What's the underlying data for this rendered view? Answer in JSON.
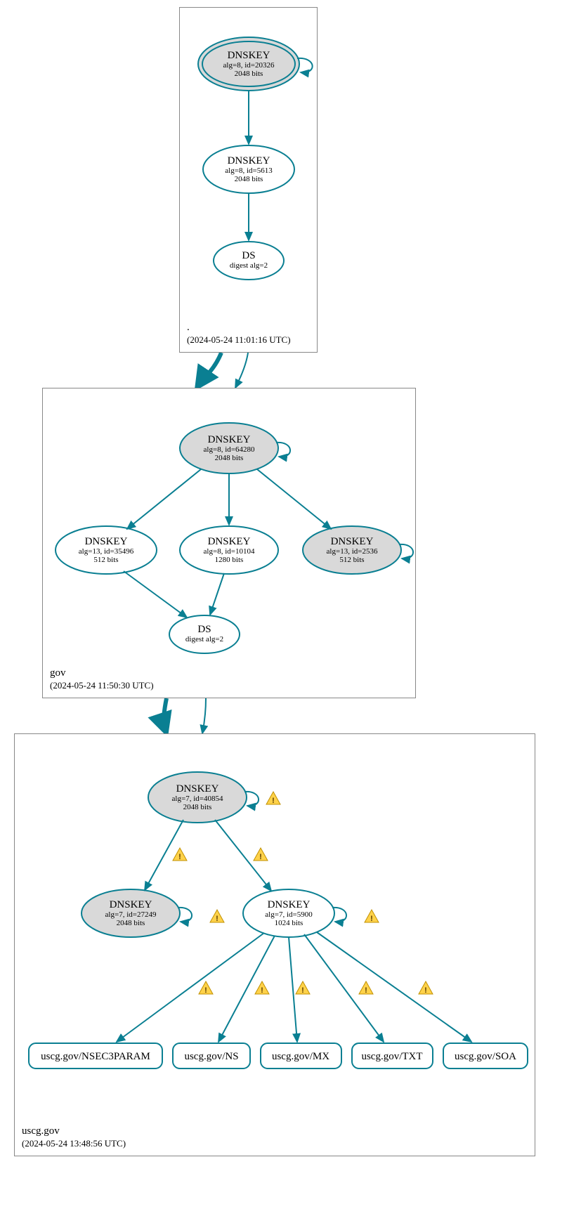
{
  "zones": {
    "root": {
      "name": ".",
      "timestamp": "(2024-05-24 11:01:16 UTC)"
    },
    "gov": {
      "name": "gov",
      "timestamp": "(2024-05-24 11:50:30 UTC)"
    },
    "uscg": {
      "name": "uscg.gov",
      "timestamp": "(2024-05-24 13:48:56 UTC)"
    }
  },
  "nodes": {
    "root_ksk": {
      "title": "DNSKEY",
      "line1": "alg=8, id=20326",
      "line2": "2048 bits"
    },
    "root_zsk": {
      "title": "DNSKEY",
      "line1": "alg=8, id=5613",
      "line2": "2048 bits"
    },
    "root_ds": {
      "title": "DS",
      "line1": "digest alg=2"
    },
    "gov_ksk": {
      "title": "DNSKEY",
      "line1": "alg=8, id=64280",
      "line2": "2048 bits"
    },
    "gov_k1": {
      "title": "DNSKEY",
      "line1": "alg=13, id=35496",
      "line2": "512 bits"
    },
    "gov_k2": {
      "title": "DNSKEY",
      "line1": "alg=8, id=10104",
      "line2": "1280 bits"
    },
    "gov_k3": {
      "title": "DNSKEY",
      "line1": "alg=13, id=2536",
      "line2": "512 bits"
    },
    "gov_ds": {
      "title": "DS",
      "line1": "digest alg=2"
    },
    "uscg_ksk": {
      "title": "DNSKEY",
      "line1": "alg=7, id=40854",
      "line2": "2048 bits"
    },
    "uscg_k1": {
      "title": "DNSKEY",
      "line1": "alg=7, id=27249",
      "line2": "2048 bits"
    },
    "uscg_k2": {
      "title": "DNSKEY",
      "line1": "alg=7, id=5900",
      "line2": "1024 bits"
    },
    "rr1": "uscg.gov/NSEC3PARAM",
    "rr2": "uscg.gov/NS",
    "rr3": "uscg.gov/MX",
    "rr4": "uscg.gov/TXT",
    "rr5": "uscg.gov/SOA"
  }
}
